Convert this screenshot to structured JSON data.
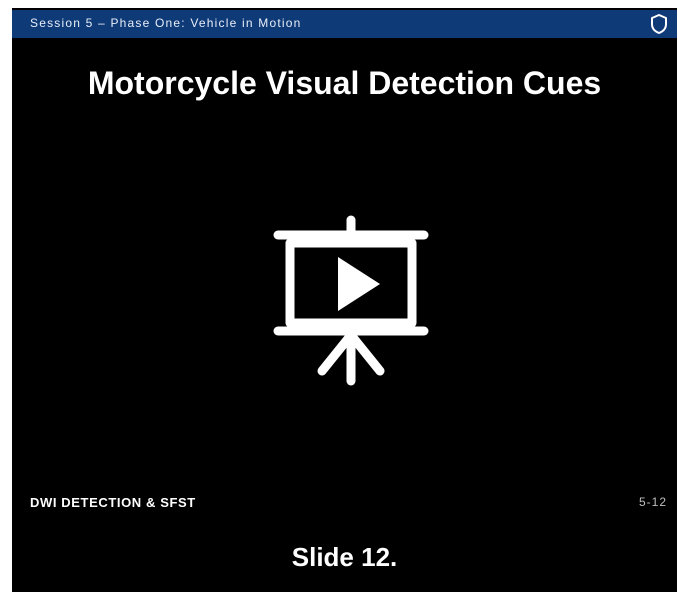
{
  "header": {
    "title": "Session 5 – Phase One: Vehicle in Motion",
    "icon": "shield-icon",
    "background_color": "#0f3a78"
  },
  "slide": {
    "title": "Motorcycle Visual Detection Cues",
    "center_icon": "video-presentation-icon",
    "background_color": "#000000"
  },
  "footer": {
    "left_text": "DWI DETECTION & SFST",
    "page_number": "5-12"
  },
  "caption": "Slide 12."
}
